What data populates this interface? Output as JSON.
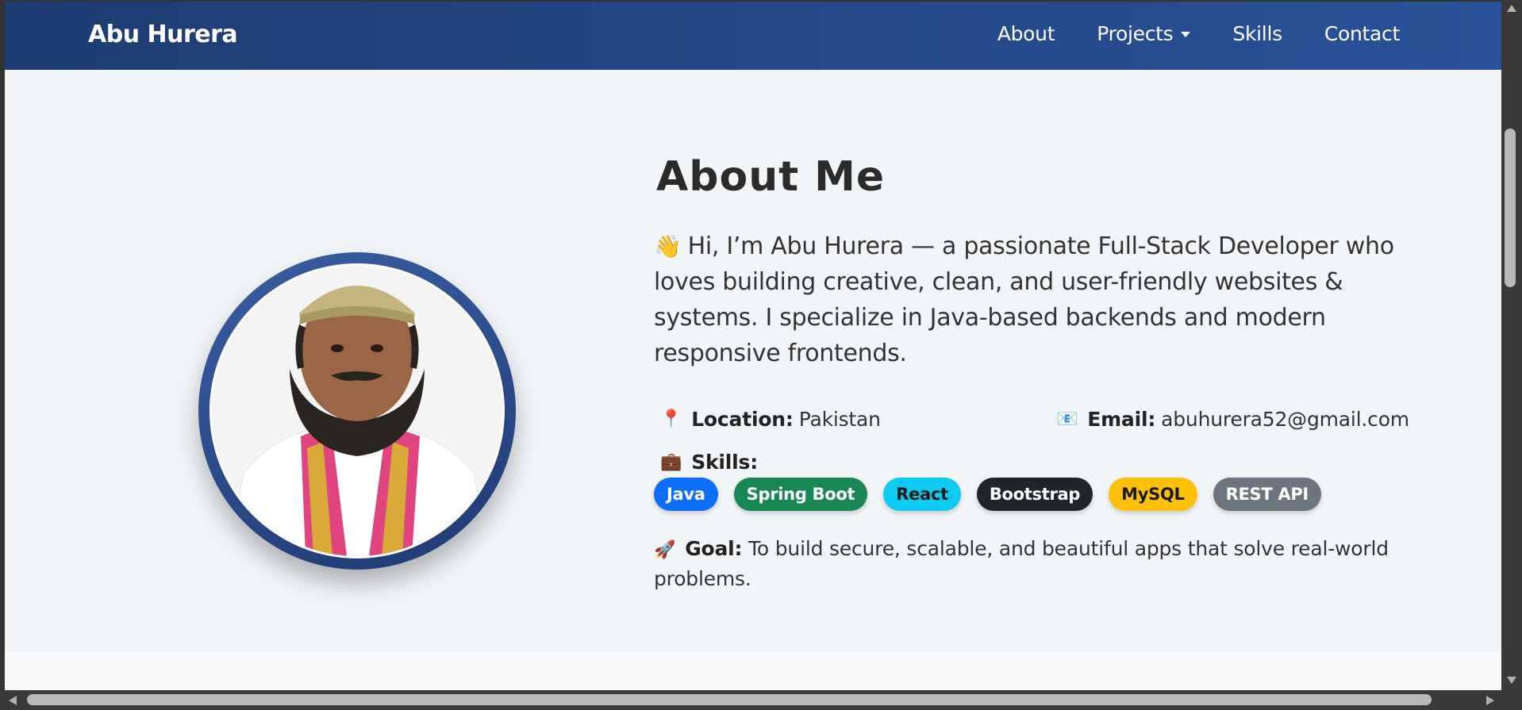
{
  "navbar": {
    "brand": "Abu Hurera",
    "links": [
      {
        "label": "About"
      },
      {
        "label": "Projects",
        "dropdown": true
      },
      {
        "label": "Skills"
      },
      {
        "label": "Contact"
      }
    ],
    "gradient_start": "#1e3c72",
    "gradient_end": "#2a5298"
  },
  "about": {
    "title": "About Me",
    "intro_emoji": "👋",
    "intro": "Hi, I’m Abu Hurera — a passionate Full-Stack Developer who loves building creative, clean, and user-friendly websites & systems. I specialize in Java-based backends and modern responsive frontends.",
    "location": {
      "emoji": "📍",
      "label": "Location:",
      "value": "Pakistan"
    },
    "email": {
      "emoji": "📧",
      "label": "Email:",
      "value": "abuhurera52@gmail.com"
    },
    "skills": {
      "emoji": "💼",
      "label": "Skills:",
      "chips": [
        {
          "label": "Java",
          "bg": "#0d6efd",
          "color": "#ffffff"
        },
        {
          "label": "Spring Boot",
          "bg": "#198754",
          "color": "#ffffff"
        },
        {
          "label": "React",
          "bg": "#0dcaf0",
          "color": "#1a1a1a"
        },
        {
          "label": "Bootstrap",
          "bg": "#212529",
          "color": "#ffffff"
        },
        {
          "label": "MySQL",
          "bg": "#ffc107",
          "color": "#1a1a1a"
        },
        {
          "label": "REST API",
          "bg": "#6c757d",
          "color": "#ffffff"
        }
      ]
    },
    "goal": {
      "emoji": "🚀",
      "label": "Goal:",
      "value": "To build secure, scalable, and beautiful apps that solve real-world problems."
    },
    "avatar_alt": "profile-photo"
  },
  "back_to_top": {
    "label": "↑"
  }
}
